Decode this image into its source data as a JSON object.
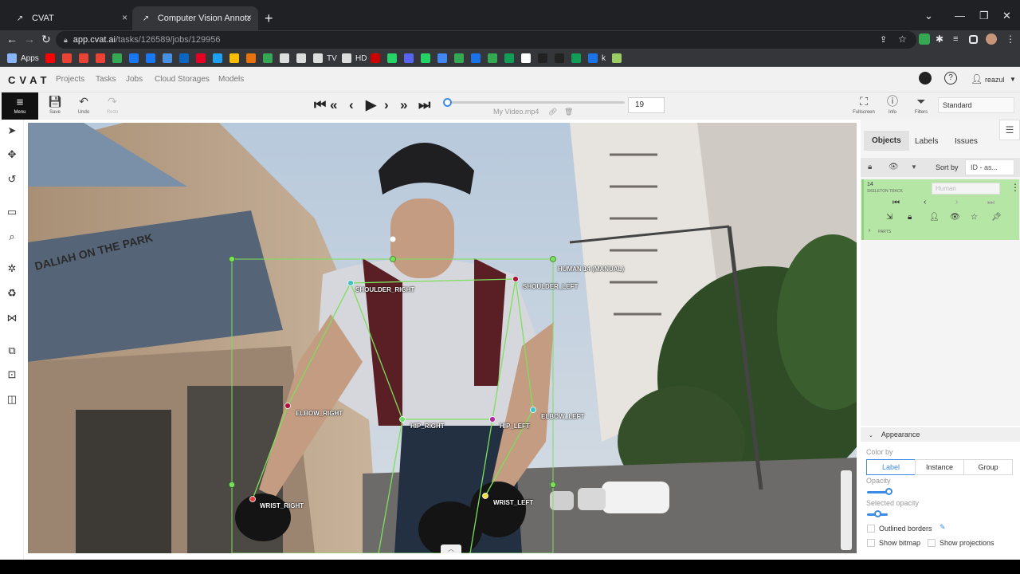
{
  "browser": {
    "tabs": [
      {
        "title": "CVAT",
        "active": false
      },
      {
        "title": "Computer Vision Annotation Tool",
        "active": true
      }
    ],
    "close_glyph": "×",
    "newtab_glyph": "+",
    "url_host": "app.cvat.ai",
    "url_path": "/tasks/126589/jobs/129956",
    "bookmarks": [
      {
        "label": "Apps",
        "color": "#8ab4f8"
      },
      {
        "label": "",
        "color": "#ff0000"
      },
      {
        "label": "",
        "color": "#ea4335"
      },
      {
        "label": "",
        "color": "#ea4335"
      },
      {
        "label": "",
        "color": "#ea4335"
      },
      {
        "label": "",
        "color": "#34a853"
      },
      {
        "label": "",
        "color": "#1877f2"
      },
      {
        "label": "",
        "color": "#1877f2"
      },
      {
        "label": "",
        "color": "#4a90e2"
      },
      {
        "label": "",
        "color": "#0a66c2"
      },
      {
        "label": "",
        "color": "#e60023"
      },
      {
        "label": "",
        "color": "#1da1f2"
      },
      {
        "label": "",
        "color": "#fbbc04"
      },
      {
        "label": "",
        "color": "#e8710a"
      },
      {
        "label": "",
        "color": "#34a853"
      },
      {
        "label": "",
        "color": "#dddddd"
      },
      {
        "label": "",
        "color": "#dddddd"
      },
      {
        "label": "TV",
        "color": "#dddddd"
      },
      {
        "label": "HD",
        "color": "#dddddd"
      },
      {
        "label": "",
        "color": "#cc0000"
      },
      {
        "label": "",
        "color": "#25d366"
      },
      {
        "label": "",
        "color": "#5865f2"
      },
      {
        "label": "",
        "color": "#25d366"
      },
      {
        "label": "",
        "color": "#4285f4"
      },
      {
        "label": "",
        "color": "#34a853"
      },
      {
        "label": "",
        "color": "#1a73e8"
      },
      {
        "label": "",
        "color": "#34a853"
      },
      {
        "label": "",
        "color": "#0f9d58"
      },
      {
        "label": "",
        "color": "#ffffff"
      },
      {
        "label": "",
        "color": "#222222"
      },
      {
        "label": "",
        "color": "#222222"
      },
      {
        "label": "",
        "color": "#0f9d58"
      },
      {
        "label": "k",
        "color": "#1a73e8"
      },
      {
        "label": "",
        "color": "#9ccc65"
      }
    ]
  },
  "header": {
    "logo": "CVAT",
    "nav": [
      "Projects",
      "Tasks",
      "Jobs",
      "Cloud Storages",
      "Models"
    ],
    "user": "reazul"
  },
  "toolbar": {
    "menu_label": "Menu",
    "save_label": "Save",
    "undo_label": "Undo",
    "redo_label": "Redo",
    "frame_number": "19",
    "filename": "My Video.mp4",
    "fullscreen_label": "Fullscreen",
    "info_label": "Info",
    "filters_label": "Filters",
    "workspace": "Standard",
    "frame_progress": 0.0
  },
  "canvas": {
    "bbox_label": "HUMAN 14 (MANUAL)",
    "keypoints": [
      {
        "name": "SHOULDER_RIGHT",
        "color": "#3fc4c8"
      },
      {
        "name": "SHOULDER_LEFT",
        "color": "#b0123e"
      },
      {
        "name": "ELBOW_RIGHT",
        "color": "#b0123e"
      },
      {
        "name": "ELBOW_LEFT",
        "color": "#3fc4c8"
      },
      {
        "name": "HIP_RIGHT",
        "color": "#6ee06a"
      },
      {
        "name": "HIP_LEFT",
        "color": "#b02aa6"
      },
      {
        "name": "WRIST_RIGHT",
        "color": "#e04040"
      },
      {
        "name": "WRIST_LEFT",
        "color": "#f0e040"
      }
    ],
    "sign_text": "DALIAH ON THE PARK",
    "skeleton_color": "#7be05a"
  },
  "sidebar": {
    "tabs": [
      "Objects",
      "Labels",
      "Issues"
    ],
    "sort_by_label": "Sort by",
    "sort_value": "ID - as...",
    "object": {
      "id": "14",
      "type": "SKELETON TRACK",
      "label": "Human",
      "parts_label": "PARTS",
      "color": "#b5e6a5"
    },
    "appearance": {
      "title": "Appearance",
      "color_by_label": "Color by",
      "color_by_options": [
        "Label",
        "Instance",
        "Group"
      ],
      "color_by_selected": "Label",
      "opacity_label": "Opacity",
      "opacity_value": 0.15,
      "selected_opacity_label": "Selected opacity",
      "selected_opacity_value": 0.15,
      "outlined_borders": "Outlined borders",
      "show_bitmap": "Show bitmap",
      "show_projections": "Show projections"
    }
  }
}
